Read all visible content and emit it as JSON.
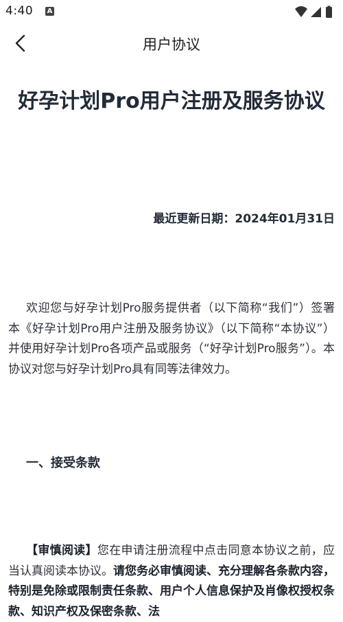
{
  "status_bar": {
    "time": "4:40",
    "notification_icon": "a-app-icon",
    "icons": [
      "wifi-icon",
      "signal-icon",
      "battery-icon"
    ]
  },
  "nav": {
    "back_icon": "chevron-left-icon",
    "title": "用户协议"
  },
  "document": {
    "title": "好孕计划Pro用户注册及服务协议",
    "update_date": "最近更新日期：2024年01月31日",
    "intro": "欢迎您与好孕计划Pro服务提供者（以下简称“我们”）签署本《好孕计划Pro用户注册及服务协议》（以下简称“本协议”）并使用好孕计划Pro各项产品或服务（“好孕计划Pro服务”）。本协议对您与好孕计划Pro具有同等法律效力。",
    "section1_heading": "一、接受条款",
    "section1_bold_lead": "【审慎阅读】",
    "section1_text": "您在申请注册流程中点击同意本协议之前，应当认真阅读本协议。",
    "section1_bold_text": "请您务必审慎阅读、充分理解各条款内容，特别是免除或限制责任条款、用户个人信息保护及肖像权授权条款、知识产权及保密条款、法"
  }
}
